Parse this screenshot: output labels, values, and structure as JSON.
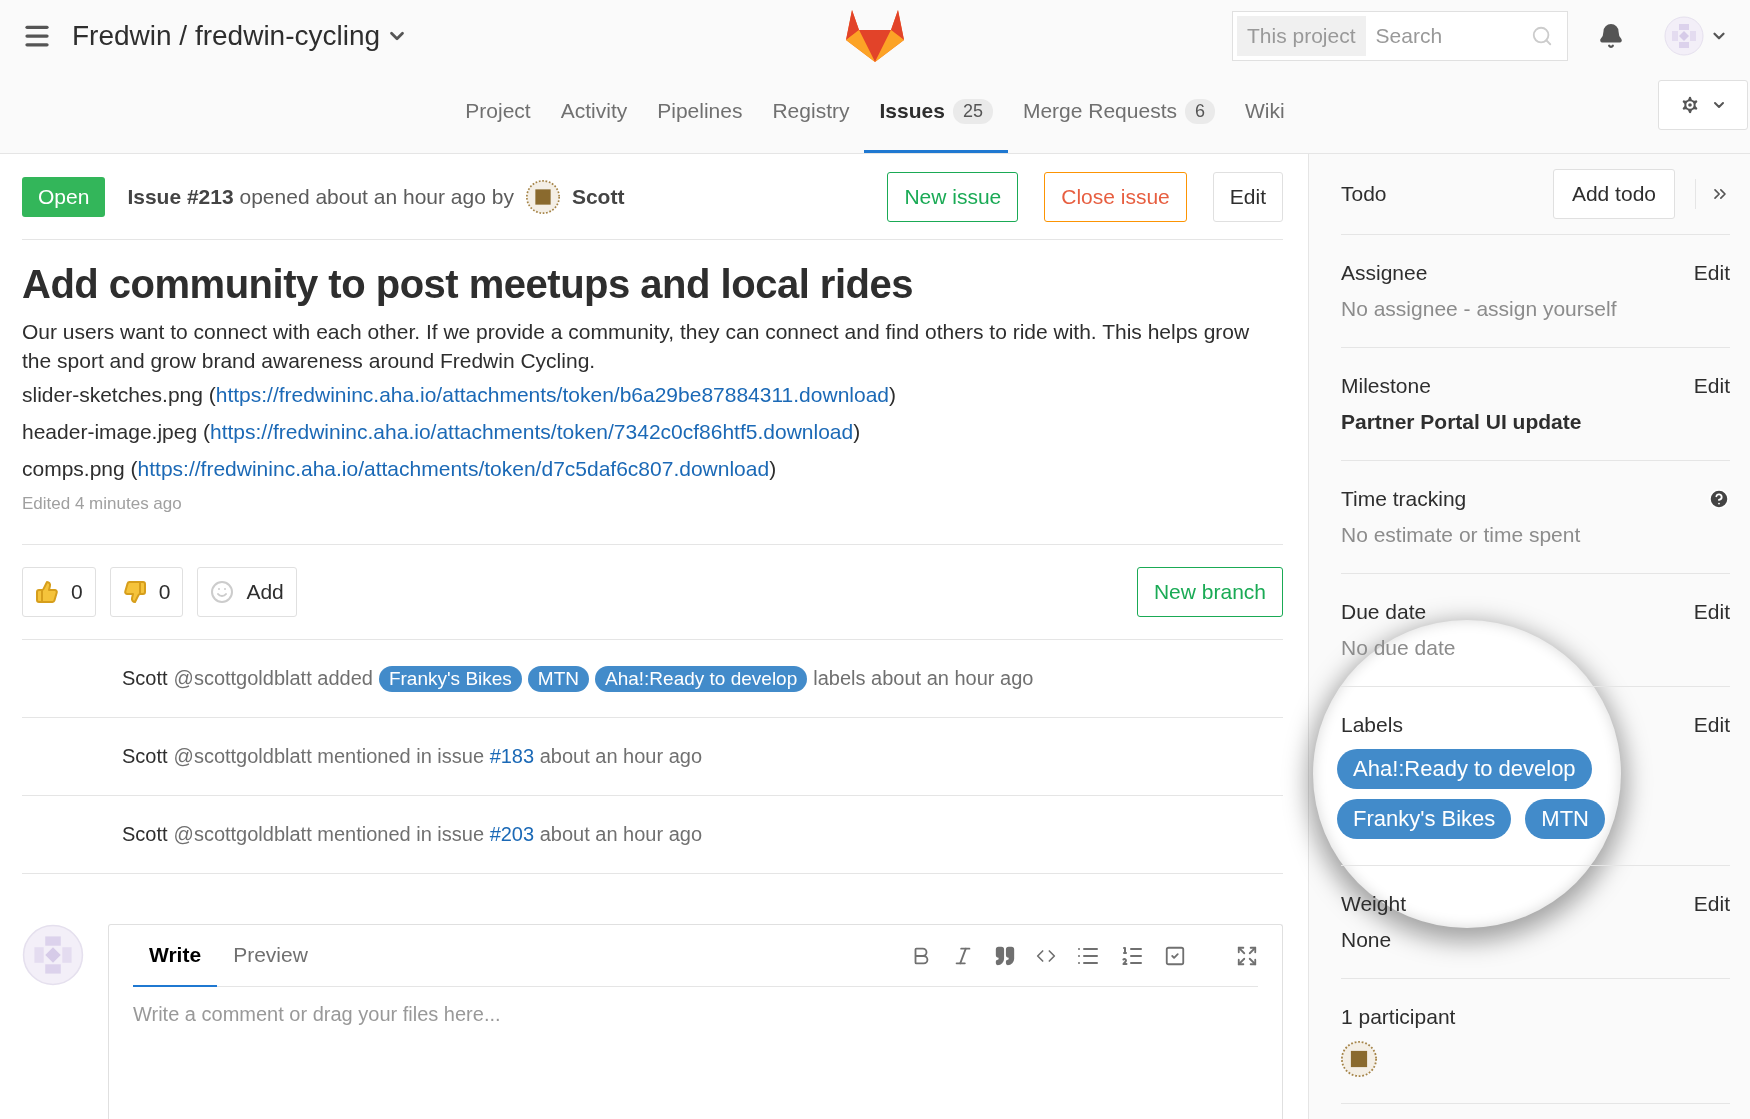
{
  "header": {
    "project_path": "Fredwin / fredwin-cycling",
    "search": {
      "scope": "This project",
      "placeholder": "Search"
    }
  },
  "nav_tabs": [
    {
      "label": "Project",
      "selected": false
    },
    {
      "label": "Activity",
      "selected": false
    },
    {
      "label": "Pipelines",
      "selected": false
    },
    {
      "label": "Registry",
      "selected": false
    },
    {
      "label": "Issues",
      "count": "25",
      "selected": true
    },
    {
      "label": "Merge Requests",
      "count": "6",
      "selected": false
    },
    {
      "label": "Wiki",
      "selected": false
    }
  ],
  "issue": {
    "status": "Open",
    "number": "Issue #213",
    "meta": "opened about an hour ago by",
    "author": "Scott",
    "buttons": [
      {
        "label": "New issue",
        "kind": "success"
      },
      {
        "label": "Close issue",
        "kind": "warning"
      },
      {
        "label": "Edit",
        "kind": "default"
      }
    ],
    "title": "Add community to post meetups and local rides",
    "description": "Our users want to connect with each other. If we provide a community, they can connect and find others to ride with. This helps grow the sport and grow brand awareness around Fredwin Cycling.",
    "attachments": [
      {
        "name": "slider-sketches.png (",
        "url": "https://fredwininc.aha.io/attachments/token/b6a29be87884311.download",
        "close": ")"
      },
      {
        "name": "header-image.jpeg (",
        "url": "https://fredwininc.aha.io/attachments/token/7342c0cf86htf5.download",
        "close": ")"
      },
      {
        "name": "comps.png (",
        "url": "https://fredwininc.aha.io/attachments/token/d7c5daf6c807.download",
        "close": ")"
      }
    ],
    "edited": "Edited 4 minutes ago"
  },
  "awards": [
    {
      "kind": "thumbsup",
      "count": "0"
    },
    {
      "kind": "thumbsdown",
      "count": "0"
    },
    {
      "kind": "add",
      "label": "Add"
    }
  ],
  "new_branch": "New branch",
  "activity": [
    {
      "kind": "labels",
      "author": "Scott",
      "text": "@scottgoldblatt added",
      "labels": [
        "Franky's Bikes",
        "MTN",
        "Aha!:Ready to develop"
      ],
      "suffix": "labels about an hour ago"
    },
    {
      "kind": "mention",
      "author": "Scott",
      "text": "@scottgoldblatt mentioned in issue",
      "ref": "#183",
      "suffix": "about an hour ago"
    },
    {
      "kind": "mention",
      "author": "Scott",
      "text": "@scottgoldblatt mentioned in issue",
      "ref": "#203",
      "suffix": "about an hour ago"
    }
  ],
  "comment": {
    "tabs": [
      {
        "label": "Write",
        "selected": true
      },
      {
        "label": "Preview",
        "selected": false
      }
    ],
    "placeholder": "Write a comment or drag your files here..."
  },
  "sidebar": {
    "todo": {
      "label": "Todo",
      "button": "Add todo"
    },
    "sections": [
      {
        "title": "Assignee",
        "action": "Edit",
        "kind": "muted",
        "value": "No assignee - assign yourself"
      },
      {
        "title": "Milestone",
        "action": "Edit",
        "kind": "bold",
        "value": "Partner Portal UI update"
      },
      {
        "title": "Time tracking",
        "help": true,
        "kind": "muted",
        "value": "No estimate or time spent"
      },
      {
        "title": "Due date",
        "action": "Edit",
        "kind": "muted",
        "value": "No due date"
      },
      {
        "title": "Labels",
        "action": "Edit",
        "kind": "labels",
        "labels": [
          "Aha!:Ready to develop",
          "Franky's Bikes",
          "MTN"
        ]
      },
      {
        "title": "Weight",
        "action": "Edit",
        "kind": "text",
        "value": "None"
      },
      {
        "title": "1 participant",
        "kind": "participants"
      }
    ]
  }
}
